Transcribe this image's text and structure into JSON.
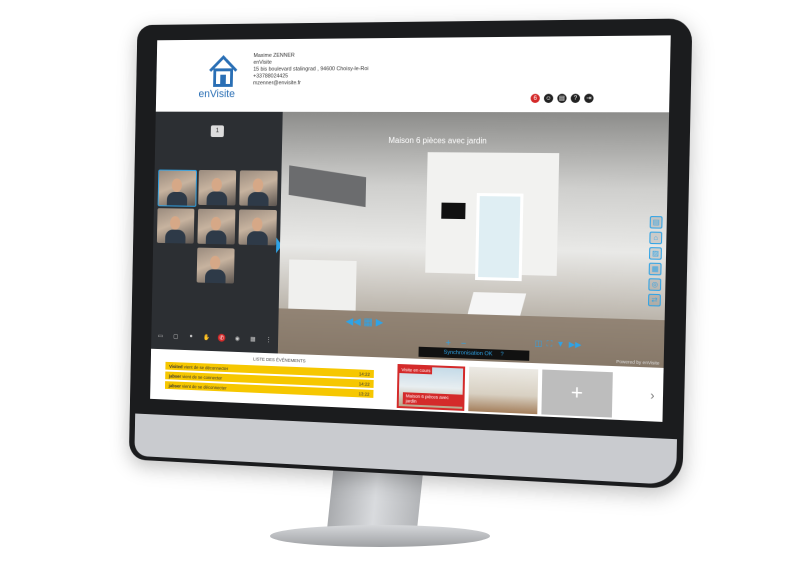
{
  "header": {
    "logo_text": "enVisite",
    "contact": {
      "name": "Maxime ZENNER",
      "company": "enVisite",
      "address": "15 bis boulevard stalingrad , 94600 Choisy-le-Roi",
      "phone": "+33788024425",
      "email": "mzenner@envisite.fr"
    },
    "badge_count": "6",
    "icons": [
      "participants-icon",
      "document-icon",
      "help-icon",
      "exit-icon"
    ]
  },
  "left_panel": {
    "cam_toggle": "1",
    "participants": [
      {
        "id": "p1"
      },
      {
        "id": "p2"
      },
      {
        "id": "p3"
      },
      {
        "id": "p4"
      },
      {
        "id": "p5"
      },
      {
        "id": "p6"
      },
      {
        "id": "p7"
      }
    ],
    "controls": [
      "chat-icon",
      "screen-icon",
      "mic-icon",
      "hand-icon",
      "hangup-icon",
      "record-icon",
      "grid-icon",
      "more-icon"
    ],
    "hangup_color": "#d42a2a"
  },
  "viewer": {
    "title": "Maison 6 pièces avec jardin",
    "sync_text": "Synchronisation OK",
    "powered_by": "Powered by enVisite",
    "accent_color": "#2fa3e6",
    "side_tools": [
      "info-icon",
      "home-icon",
      "gallery-icon",
      "floorplan-icon",
      "location-icon",
      "share-icon"
    ],
    "zoom_in": "+",
    "zoom_out": "−"
  },
  "events": {
    "title": "LISTE DES ÉVÉNEMENTS",
    "items": [
      {
        "user": "Visited",
        "text": "vient de se déconnecter",
        "time": "14:22"
      },
      {
        "user": "jabser",
        "text": "vient de se connecter",
        "time": "14:22"
      },
      {
        "user": "jabser",
        "text": "vient de se déconnecter",
        "time": "13:22"
      }
    ],
    "highlight_color": "#f6c700"
  },
  "properties": {
    "active_tag": "Visite en cours",
    "active_name": "Maison 6 pièces avec jardin",
    "add_label": "+",
    "next_label": "›"
  }
}
